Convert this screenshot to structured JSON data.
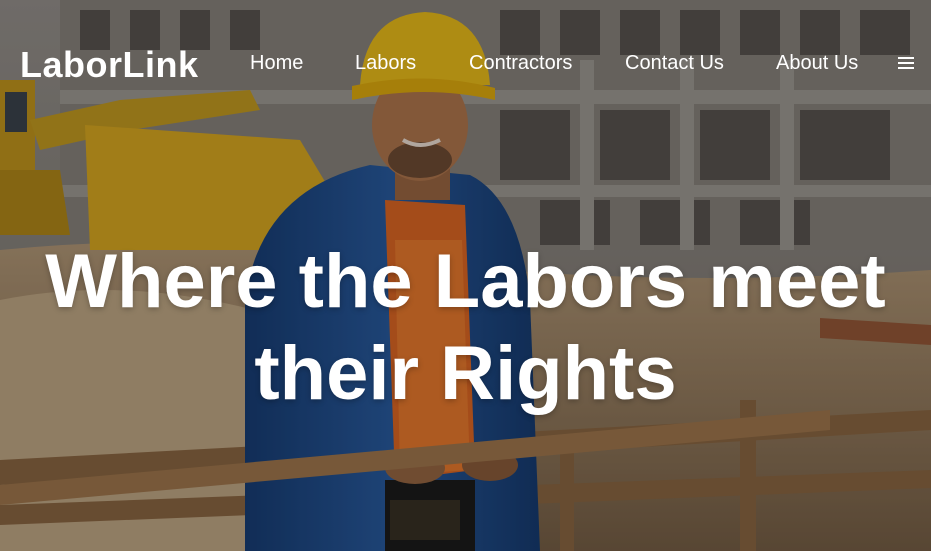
{
  "brand": {
    "name": "LaborLink"
  },
  "nav": {
    "items": [
      {
        "label": "Home"
      },
      {
        "label": "Labors"
      },
      {
        "label": "Contractors"
      },
      {
        "label": "Contact Us"
      },
      {
        "label": "About Us"
      }
    ],
    "menu_icon": "hamburger-menu-icon"
  },
  "hero": {
    "headline_line1": "Where the Labors meet",
    "headline_line2": "their Rights",
    "background_image": "construction-worker-hard-hat-site"
  },
  "colors": {
    "text": "#ffffff",
    "hard_hat": "#f2c21b",
    "jacket": "#1f4f8f",
    "vest": "#e9702a",
    "machinery": "#d9a21c"
  }
}
